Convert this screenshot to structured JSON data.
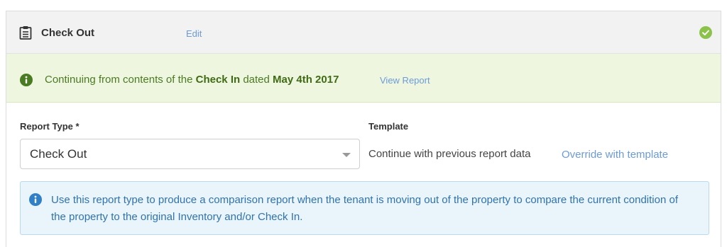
{
  "header": {
    "title": "Check Out",
    "edit_label": "Edit",
    "icons": {
      "left": "clipboard-icon",
      "right": "check-circle-icon"
    },
    "accent_green": "#8bc34a"
  },
  "continuing_notice": {
    "prefix": "Continuing from contents of the ",
    "report_name": "Check In",
    "middle": " dated ",
    "date": "May 4th 2017",
    "view_report_label": "View Report",
    "icon": "info-icon",
    "background": "#eef6e0",
    "text_color": "#4a7a21"
  },
  "form": {
    "report_type_label": "Report Type *",
    "report_type_value": "Check Out",
    "template_label": "Template",
    "template_value": "Continue with previous report data",
    "override_label": "Override with template"
  },
  "info_notice": {
    "text": "Use this report type to produce a comparison report when the tenant is moving out of the property to compare the current condition of the property to the original Inventory and/or Check In.",
    "icon": "info-icon",
    "background": "#eaf4fb",
    "text_color": "#2f73ae"
  },
  "link_color": "#6b9bd8"
}
